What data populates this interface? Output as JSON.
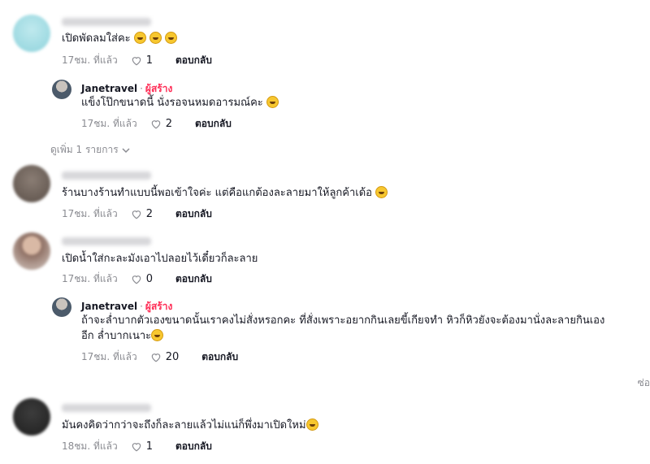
{
  "comments": [
    {
      "text": "เปิดพัดลมใส่คะ",
      "emoji_count": 3,
      "time": "17ชม. ที่แล้ว",
      "likes": "1",
      "reply_label": "ตอบกลับ",
      "reply": {
        "author": "Janetravel",
        "creator_label": "ผู้สร้าง",
        "text": "แข็งโป๊กขนาดนี้ นั่งรอจนหมดอารมณ์คะ",
        "emoji_count": 1,
        "time": "17ชม. ที่แล้ว",
        "likes": "2",
        "reply_label": "ตอบกลับ"
      },
      "view_more": "ดูเพิ่ม 1 รายการ"
    },
    {
      "text": "ร้านบางร้านทำแบบนี้พอเข้าใจค่ะ แต่คือแกต้องละลายมาให้ลูกค้าเด้อ",
      "emoji_count": 1,
      "time": "17ชม. ที่แล้ว",
      "likes": "2",
      "reply_label": "ตอบกลับ"
    },
    {
      "text": "เปิดน้ำใส่กะละมังเอาไปลอยไว้เดี๋ยวก็ละลาย",
      "emoji_count": 0,
      "time": "17ชม. ที่แล้ว",
      "likes": "0",
      "reply_label": "ตอบกลับ",
      "reply": {
        "author": "Janetravel",
        "creator_label": "ผู้สร้าง",
        "text_line1": "ถ้าจะล่ำบากตัวเองขนาดนั้นเราคงไม่สั่งหรอกคะ ที่สั่งเพราะอยากกินเลยขี้เกียจทำ หิวก็หิวยังจะต้องมานั่งละลายกินเอง",
        "text_line2": "อีก ล่ำบากเนาะ",
        "emoji_count": 1,
        "time": "17ชม. ที่แล้ว",
        "likes": "20",
        "reply_label": "ตอบกลับ"
      },
      "edge_text": "ซ่อ"
    },
    {
      "text": "มันคงคิดว่ากว่าจะถึงก็ละลายแล้วไม่แน่ก็พึ่งมาเปิดใหม่",
      "emoji_count": 1,
      "time": "18ชม. ที่แล้ว",
      "likes": "1",
      "reply_label": "ตอบกลับ"
    }
  ],
  "colors": {
    "creator": "#fe2c55",
    "muted": "#8a8b91",
    "text": "#161823"
  },
  "icons": {
    "like": "heart-outline-icon",
    "expand": "chevron-down-icon"
  }
}
